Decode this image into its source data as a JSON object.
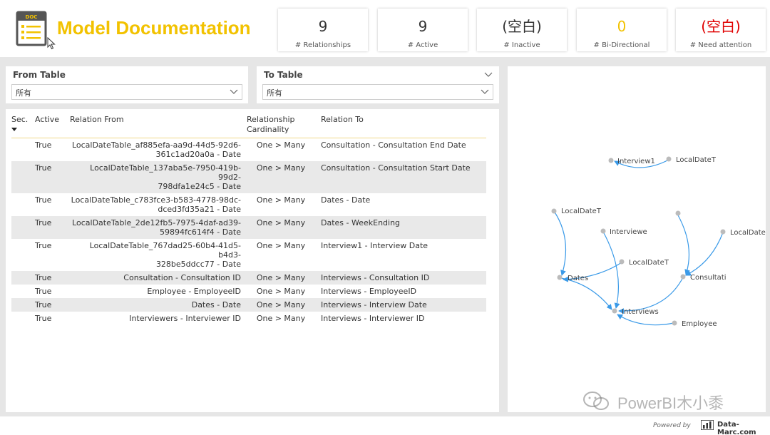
{
  "header": {
    "title": "Model Documentation",
    "logo_text": "DOC",
    "logo_icon": "document-list-icon",
    "accent_color": "#f2c200"
  },
  "kpis": [
    {
      "value": "9",
      "label": "# Relationships",
      "color": "#333333"
    },
    {
      "value": "9",
      "label": "# Active",
      "color": "#333333"
    },
    {
      "value": "(空白)",
      "label": "# Inactive",
      "color": "#333333"
    },
    {
      "value": "0",
      "label": "# Bi-Directional",
      "color": "#f2c200"
    },
    {
      "value": "(空白)",
      "label": "# Need attention",
      "color": "#e00000"
    }
  ],
  "filters": {
    "from_table": {
      "label": "From Table",
      "value": "所有"
    },
    "to_table": {
      "label": "To Table",
      "value": "所有"
    }
  },
  "table": {
    "headers": {
      "sec": "Sec.",
      "active": "Active",
      "relation_from": "Relation From",
      "cardinality_1": "Relationship",
      "cardinality_2": "Cardinality",
      "relation_to": "Relation To"
    },
    "rows": [
      {
        "active": "True",
        "from_1": "LocalDateTable_af885efa-aa9d-44d5-92d6-",
        "from_2": "361c1ad20a0a - Date",
        "card": "One > Many",
        "to": "Consultation - Consultation End Date"
      },
      {
        "active": "True",
        "from_1": "LocalDateTable_137aba5e-7950-419b-99d2-",
        "from_2": "798dfa1e24c5 - Date",
        "card": "One > Many",
        "to": "Consultation - Consultation Start Date"
      },
      {
        "active": "True",
        "from_1": "LocalDateTable_c783fce3-b583-4778-98dc-",
        "from_2": "dced3fd35a21 - Date",
        "card": "One > Many",
        "to": "Dates - Date"
      },
      {
        "active": "True",
        "from_1": "LocalDateTable_2de12fb5-7975-4daf-ad39-",
        "from_2": "59894fc614f4 - Date",
        "card": "One > Many",
        "to": "Dates - WeekEnding"
      },
      {
        "active": "True",
        "from_1": "LocalDateTable_767dad25-60b4-41d5-b4d3-",
        "from_2": "328be5ddcc77 - Date",
        "card": "One > Many",
        "to": "Interview1 - Interview Date"
      },
      {
        "active": "True",
        "from_1": "Consultation - Consultation ID",
        "from_2": "",
        "card": "One > Many",
        "to": "Interviews - Consultation ID"
      },
      {
        "active": "True",
        "from_1": "Employee - EmployeeID",
        "from_2": "",
        "card": "One > Many",
        "to": "Interviews - EmployeeID"
      },
      {
        "active": "True",
        "from_1": "Dates - Date",
        "from_2": "",
        "card": "One > Many",
        "to": "Interviews - Interview Date"
      },
      {
        "active": "True",
        "from_1": "Interviewers - Interviewer ID",
        "from_2": "",
        "card": "One > Many",
        "to": "Interviews - Interviewer ID"
      }
    ]
  },
  "graph": {
    "edge_color": "#3a9ae8",
    "node_color": "#bbbbbb",
    "nodes": {
      "interview1": "Interview1",
      "localdatet_top": "LocalDateT",
      "localdatet_left": "LocalDateT",
      "interviewe": "Interviewe",
      "localdatet_mid": "LocalDateT",
      "localdate_right": "LocalDate",
      "dates": "Dates",
      "consultati": "Consultati",
      "interviews": "Interviews",
      "employee": "Employee"
    }
  },
  "footer": {
    "powered_by": "Powered by",
    "brand": "Data-Marc.com"
  },
  "watermark": {
    "text": "PowerBI木小黍"
  }
}
